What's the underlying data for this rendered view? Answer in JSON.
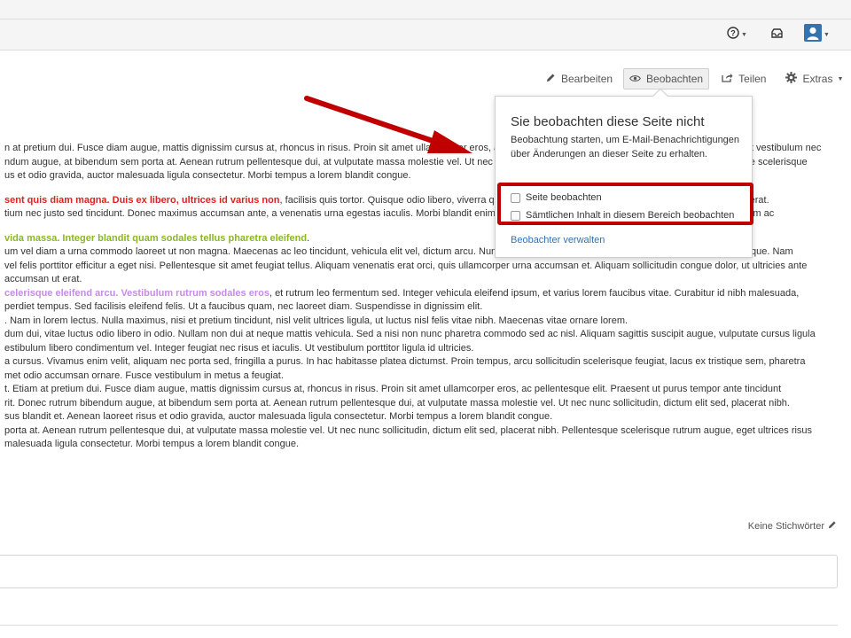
{
  "header": {
    "help_icon": "help-circle-icon",
    "notifications_icon": "inbox-tray-icon",
    "user_icon": "user-avatar-icon",
    "avatar_color": "#3572b0"
  },
  "toolbar": {
    "edit_label": "Bearbeiten",
    "watch_label": "Beobachten",
    "share_label": "Teilen",
    "extras_label": "Extras"
  },
  "content": {
    "paragraphs": [
      {
        "lines": [
          [
            {
              "t": "n at pretium dui. Fusce diam augue, mattis dignissim cursus at, rhoncus in risus. Proin sit amet ullamcorper eros, ac pellentesque elit. Praesent ut purus tempor ante tincidunt vestibulum nec"
            }
          ],
          [
            {
              "t": "ndum augue, at bibendum sem porta at. Aenean rutrum pellentesque dui, at vulputate massa molestie vel. Ut nec nunc sollicitudin, dictum elit sed, placerat nibh. Pellentesque scelerisque"
            }
          ],
          [
            {
              "t": "us et odio gravida, auctor malesuada ligula consectetur. Morbi tempus a lorem blandit congue."
            }
          ]
        ]
      },
      {
        "lines": [
          [
            {
              "t": "sent quis diam magna. Duis ex libero, ultrices id varius non",
              "s": "red"
            },
            {
              "t": ", facilisis quis tortor. Quisque odio libero, viverra quis tellus et, pretium luctus lacus. Quisque non, quis luctus erat."
            }
          ],
          [
            {
              "t": "tium nec justo sed tincidunt. Donec maximus accumsan ante, a venenatis urna egestas iaculis. Morbi blandit enim dui, vitae luctus odio libero in odio. Pellentesque rutrum enim ac"
            }
          ]
        ]
      },
      {
        "lines": [
          [
            {
              "t": "vida massa. Integer blandit quam sodales tellus pharetra eleifend",
              "s": "green"
            },
            {
              "t": "."
            }
          ],
          [
            {
              "t": "um vel diam a urna commodo laoreet ut non magna. Maecenas ac leo tincidunt, vehicula elit vel, dictum arcu. Nunc non pharetra neque. Maecenas accumsan malesuada neque. Nam"
            }
          ],
          [
            {
              "t": " vel felis porttitor efficitur a eget nisi. Pellentesque sit amet feugiat tellus. Aliquam venenatis erat orci, quis ullamcorper urna accumsan et. Aliquam sollicitudin congue dolor, ut ultricies ante"
            }
          ],
          [
            {
              "t": "accumsan ut erat."
            }
          ],
          [
            {
              "t": "celerisque eleifend arcu. Vestibulum rutrum sodales eros",
              "s": "purple"
            },
            {
              "t": ", et rutrum leo fermentum sed. Integer vehicula eleifend ipsum, et varius lorem faucibus vitae. Curabitur id nibh malesuada,"
            }
          ],
          [
            {
              "t": "perdiet tempus. Sed facilisis eleifend felis. Ut a faucibus quam, nec laoreet diam. Suspendisse in dignissim elit."
            }
          ],
          [
            {
              "t": ". Nam in lorem lectus. Nulla maximus, nisi et pretium tincidunt, nisl velit ultrices ligula, ut luctus nisl felis vitae nibh. Maecenas vitae ornare lorem."
            }
          ],
          [
            {
              "t": "dum dui, vitae luctus odio libero in odio. Nullam non dui at neque mattis vehicula. Sed a nisi non nunc pharetra commodo sed ac nisl. Aliquam sagittis suscipit augue, vulputate cursus ligula"
            }
          ],
          [
            {
              "t": "estibulum libero condimentum vel. Integer feugiat nec risus et iaculis. Ut vestibulum porttitor ligula id ultricies."
            }
          ],
          [
            {
              "t": "a cursus. Vivamus enim velit, aliquam nec porta sed, fringilla a purus. In hac habitasse platea dictumst. Proin tempus, arcu sollicitudin scelerisque feugiat, lacus ex tristique sem, pharetra"
            }
          ],
          [
            {
              "t": "met odio accumsan ornare. Fusce vestibulum in metus a feugiat."
            }
          ],
          [
            {
              "t": "t. Etiam at pretium dui. Fusce diam augue, mattis dignissim cursus at, rhoncus in risus. Proin sit amet ullamcorper eros, ac pellentesque elit. Praesent ut purus tempor ante tincidunt"
            }
          ],
          [
            {
              "t": "rit. Donec rutrum bibendum augue, at bibendum sem porta at. Aenean rutrum pellentesque dui, at vulputate massa molestie vel. Ut nec nunc sollicitudin, dictum elit sed, placerat nibh."
            }
          ],
          [
            {
              "t": "sus blandit et. Aenean laoreet risus et odio gravida, auctor malesuada ligula consectetur. Morbi tempus a lorem blandit congue."
            }
          ],
          [
            {
              "t": " porta at. Aenean rutrum pellentesque dui, at vulputate massa molestie vel. Ut nec nunc sollicitudin, dictum elit sed, placerat nibh. Pellentesque scelerisque rutrum augue, eget ultrices risus"
            }
          ],
          [
            {
              "t": " malesuada ligula consectetur. Morbi tempus a lorem blandit congue."
            }
          ]
        ]
      }
    ]
  },
  "labels": {
    "no_tags": "Keine Stichwörter"
  },
  "watch_popup": {
    "title": "Sie beobachten diese Seite nicht",
    "description": "Beobachtung starten, um E-Mail-Benachrichtigungen über Änderungen an dieser Seite zu erhalten.",
    "option_page": "Seite beobachten",
    "option_space": "Sämtlichen Inhalt in diesem Bereich beobachten",
    "manage_link": "Beobachter verwalten"
  },
  "annotation": {
    "color": "#c00000"
  }
}
